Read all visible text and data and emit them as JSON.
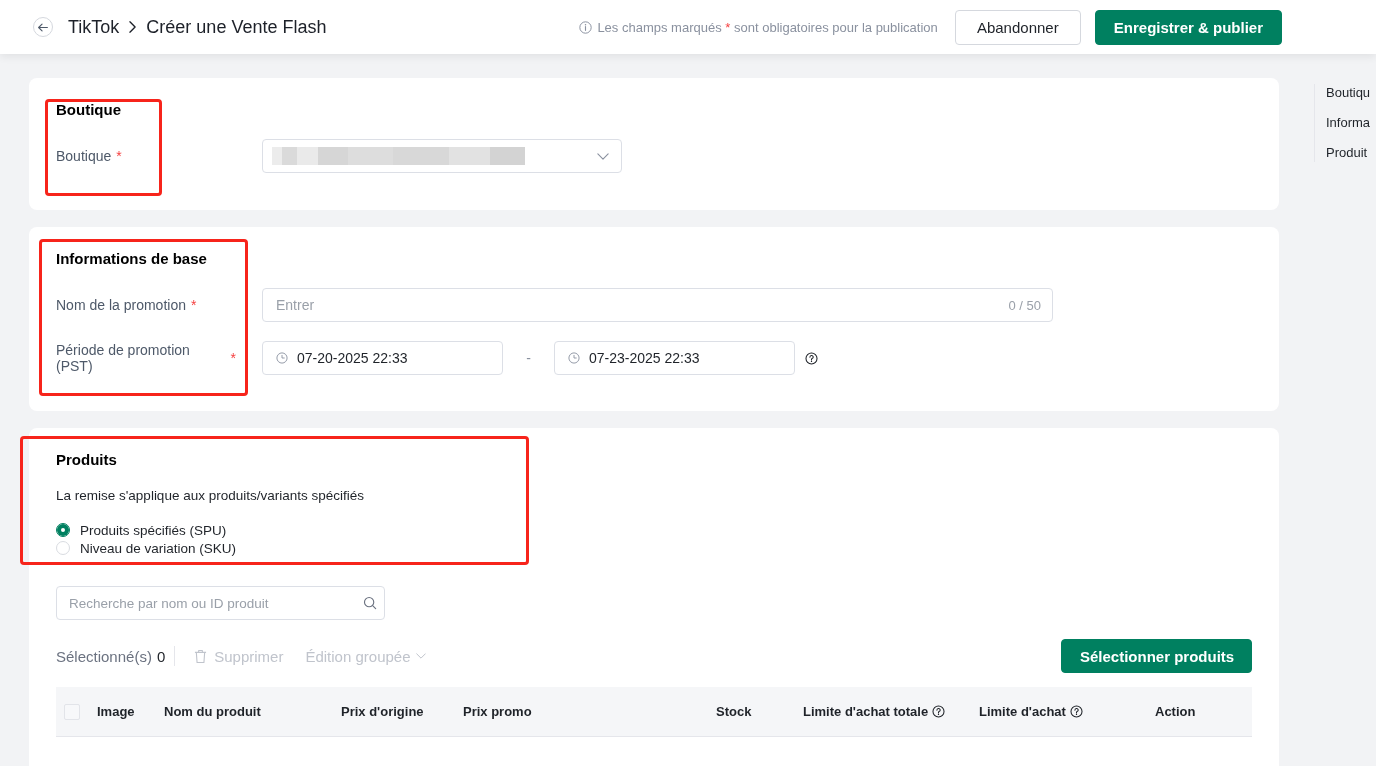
{
  "header": {
    "breadcrumb": [
      "TikTok",
      "Créer une Vente Flash"
    ],
    "notice": [
      {
        "kind": "text",
        "text": "Les champs marqués"
      },
      {
        "kind": "required",
        "text": "*"
      },
      {
        "kind": "text",
        "text": "sont obligatoires pour la publication"
      }
    ],
    "buttons": [
      {
        "kind": "cancel",
        "label": "Abandonner"
      },
      {
        "kind": "publish",
        "label": "Enregistrer & publier"
      }
    ]
  },
  "sections": [
    {
      "kind": "shop",
      "title": "Boutique",
      "highlighted": true,
      "fields": [
        {
          "kind": "select",
          "label": "Boutique",
          "required_mark": "*",
          "value_redacted": true
        }
      ]
    },
    {
      "kind": "basic",
      "title": "Informations de base",
      "highlighted": true,
      "fields": [
        {
          "kind": "text",
          "label": "Nom de la promotion",
          "required_mark": "*",
          "placeholder": "Entrer",
          "counter": "0 / 50"
        },
        {
          "kind": "date_range",
          "label": "Période de promotion (PST)",
          "required_mark": "*",
          "start": "07-20-2025 22:33",
          "separator": "-",
          "end": "07-23-2025 22:33",
          "help": true
        }
      ]
    },
    {
      "kind": "products",
      "title": "Produits",
      "highlighted": true,
      "description": "La remise s'applique aux produits/variants spécifiés",
      "options": [
        {
          "label": "Produits spécifiés (SPU)",
          "selected": true
        },
        {
          "label": "Niveau de variation (SKU)",
          "selected": false
        }
      ],
      "search": {
        "placeholder": "Recherche par nom ou ID produit"
      },
      "toolbar": {
        "selected_label": "Sélectionné(s)",
        "selected_count": "0",
        "actions": [
          {
            "kind": "delete",
            "label": "Supprimer",
            "disabled": true
          },
          {
            "kind": "bulk_edit",
            "label": "Édition groupée",
            "disabled": true
          }
        ],
        "button": "Sélectionner produits"
      },
      "table": {
        "select_all": {
          "checked": false
        },
        "columns": [
          {
            "label": "Image",
            "help": false
          },
          {
            "label": "Nom du produit",
            "help": false
          },
          {
            "label": "Prix d'origine",
            "help": false
          },
          {
            "label": "Prix promo",
            "help": false
          },
          {
            "label": "Stock",
            "help": false
          },
          {
            "label": "Limite d'achat totale",
            "help": true
          },
          {
            "label": "Limite d'achat",
            "help": true
          },
          {
            "label": "Action",
            "help": false
          }
        ]
      }
    }
  ],
  "anchor_nav": [
    "Boutiqu",
    "Informa",
    "Produit"
  ]
}
